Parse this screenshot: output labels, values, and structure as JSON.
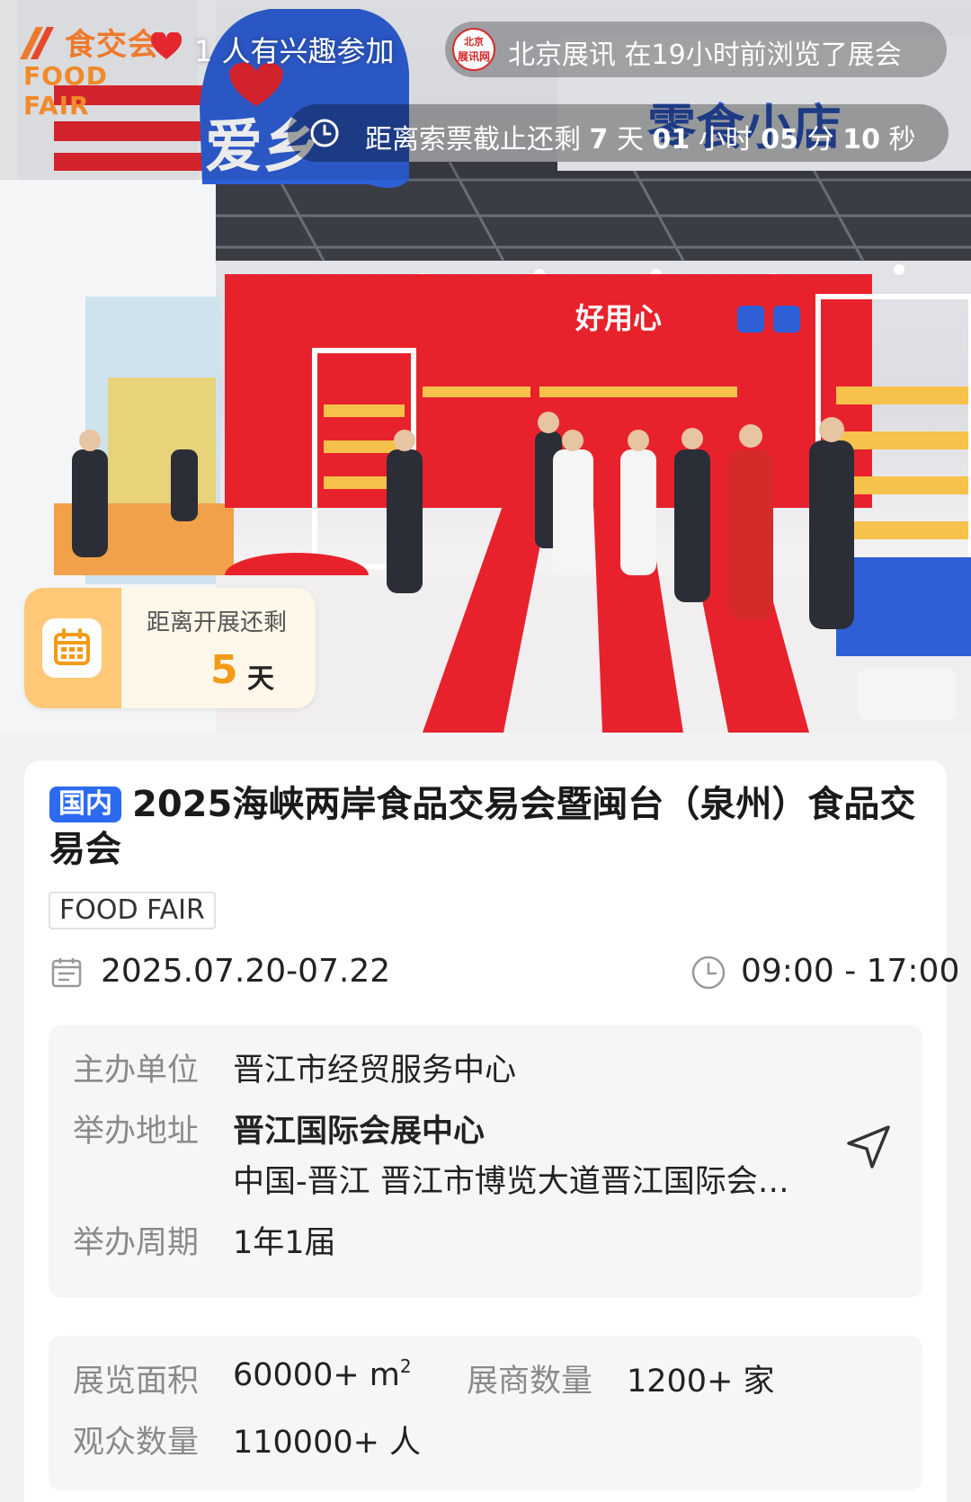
{
  "hero": {
    "logo_cn": "食交会",
    "logo_en": "FOOD FAIR",
    "interest_text": "1 人有兴趣参加",
    "source": {
      "avatar_line1": "北京",
      "avatar_line2": "展讯网",
      "text": "北京展讯 在19小时前浏览了展会"
    },
    "deadline": {
      "prefix": "距离索票截止还剩",
      "days": "7",
      "days_unit": "天",
      "hours": "01",
      "hours_unit": "小时",
      "minutes": "05",
      "minutes_unit": "分",
      "seconds": "10",
      "seconds_unit": "秒"
    },
    "open_countdown": {
      "label": "距离开展还剩",
      "value": "5",
      "unit": "天"
    }
  },
  "exhibition": {
    "tag": "国内",
    "title": "2025海峡两岸食品交易会暨闽台（泉州）食品交易会",
    "en_tag": "FOOD FAIR",
    "date": "2025.07.20-07.22",
    "time": "09:00 - 17:00"
  },
  "details": {
    "organizer_label": "主办单位",
    "organizer": "晋江市经贸服务中心",
    "venue_label": "举办地址",
    "venue_name": "晋江国际会展中心",
    "venue_address": "中国-晋江 晋江市博览大道晋江国际会展中心",
    "cycle_label": "举办周期",
    "cycle": "1年1届"
  },
  "stats": {
    "area_label": "展览面积",
    "area_value": "60000+ m",
    "area_sup": "2",
    "exhibitors_label": "展商数量",
    "exhibitors_value": "1200+ 家",
    "visitors_label": "观众数量",
    "visitors_value": "110000+ 人"
  },
  "colors": {
    "accent_blue": "#2c6bf0",
    "countdown_orange": "#f39b17",
    "badge_bg": "#ffc876",
    "booth_red": "#e8222c"
  },
  "icons": {
    "clock": "clock-icon",
    "calendar": "calendar-icon",
    "navigate": "navigate-arrow-icon"
  }
}
